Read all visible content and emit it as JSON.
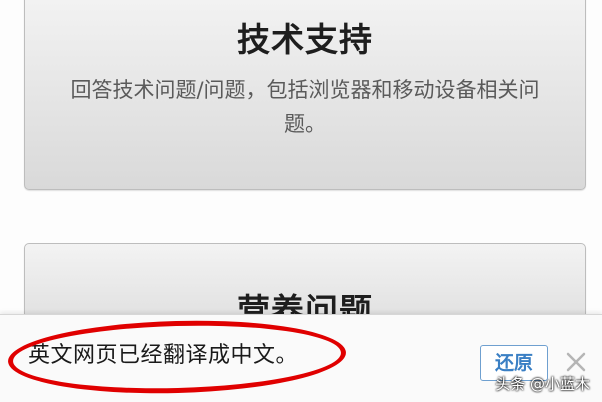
{
  "cards": [
    {
      "title": "技术支持",
      "description": "回答技术问题/问题，包括浏览器和移动设备相关问题。"
    },
    {
      "title": "营养问题"
    }
  ],
  "translation_banner": {
    "message": "英文网页已经翻译成中文。",
    "restore_label": "还原",
    "close_icon": "close-icon"
  },
  "watermark": "头条 @小蓝木",
  "colors": {
    "annotation_red": "#e00000",
    "restore_button_blue": "#3a7fc4"
  }
}
